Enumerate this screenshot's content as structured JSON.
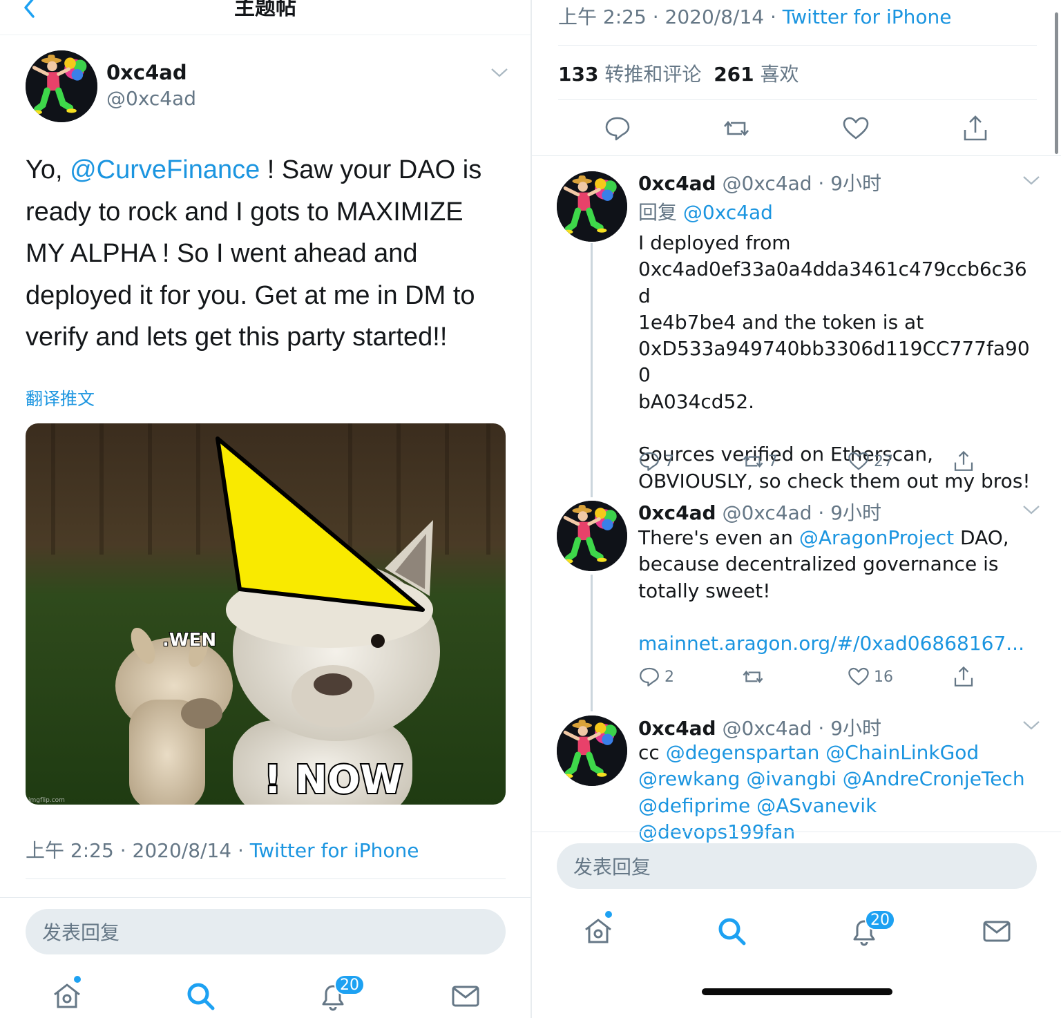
{
  "colors": {
    "accent": "#1da1f2",
    "link": "#1b95e0",
    "muted": "#657786",
    "text": "#14171a"
  },
  "left": {
    "nav_title": "主题帖",
    "author": {
      "name": "0xc4ad",
      "handle": "@0xc4ad"
    },
    "tweet": {
      "seg1": "Yo, ",
      "mention": "@CurveFinance",
      "seg2": " ! Saw your DAO is ready to rock and I gots to MAXIMIZE MY ALPHA ! So I went ahead and deployed it for you. Get at me in DM to verify and lets get this party started!!"
    },
    "translate": "翻译推文",
    "image": {
      "text_top": ".WEN",
      "text_bottom": "! NOW",
      "watermark": "imgflip.com"
    },
    "meta": {
      "time": "上午 2:25",
      "sep1": "·",
      "date": "2020/8/14",
      "sep2": "·",
      "via": "Twitter for iPhone"
    },
    "reply_placeholder": "发表回复",
    "tabs": {
      "badge": "20"
    }
  },
  "right": {
    "meta": {
      "time": "上午 2:25",
      "sep1": "·",
      "date": "2020/8/14",
      "sep2": "·",
      "via": "Twitter for iPhone"
    },
    "stats": {
      "retweets": "133",
      "retweets_label": "转推和评论",
      "likes": "261",
      "likes_label": "喜欢"
    },
    "replies": [
      {
        "name": "0xc4ad",
        "handle": "@0xc4ad",
        "sep": "·",
        "age": "9小时",
        "reply_to_label": "回复",
        "reply_to": "@0xc4ad",
        "body_lines": [
          "I deployed from",
          "0xc4ad0ef33a0a4dda3461c479ccb6c36d",
          "1e4b7be4 and the token is at",
          "0xD533a949740bb3306d119CC777fa900",
          "bA034cd52.",
          "",
          "Sources verified on Etherscan,",
          "OBVIOUSLY, so check them out my bros!"
        ],
        "counts": {
          "replies": "7",
          "retweets": "7",
          "likes": "27"
        }
      },
      {
        "name": "0xc4ad",
        "handle": "@0xc4ad",
        "sep": "·",
        "age": "9小时",
        "body_pre": "There's even an ",
        "mention": "@AragonProject",
        "body_post_lines": [
          " DAO,",
          "because decentralized governance is",
          "totally sweet!"
        ],
        "link": "mainnet.aragon.org/#/0xad06868167...",
        "counts": {
          "replies": "2",
          "retweets": "",
          "likes": "16"
        }
      },
      {
        "name": "0xc4ad",
        "handle": "@0xc4ad",
        "sep": "·",
        "age": "9小时",
        "body_pre": "cc ",
        "mention_lines": [
          "@degenspartan @ChainLinkGod",
          "@rewkang @ivangbi @AndreCronjeTech",
          "@defiprime @ASvanevik @devops199fan"
        ]
      }
    ],
    "reply_placeholder": "发表回复",
    "tabs": {
      "badge": "20"
    }
  }
}
